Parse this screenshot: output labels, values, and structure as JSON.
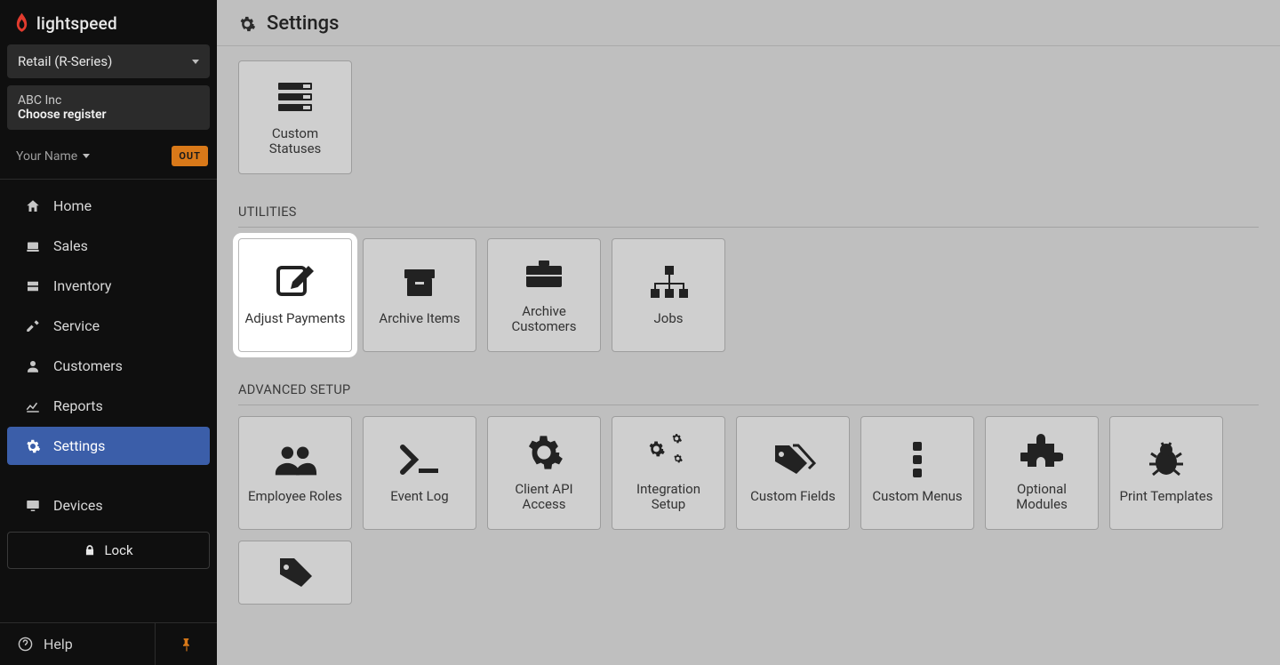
{
  "brand": {
    "name": "lightspeed"
  },
  "product_switcher": {
    "label": "Retail (R-Series)"
  },
  "register": {
    "org": "ABC Inc",
    "choose": "Choose register"
  },
  "user": {
    "name": "Your Name",
    "status_badge": "OUT"
  },
  "nav": {
    "items": [
      {
        "key": "home",
        "label": "Home"
      },
      {
        "key": "sales",
        "label": "Sales"
      },
      {
        "key": "inventory",
        "label": "Inventory"
      },
      {
        "key": "service",
        "label": "Service"
      },
      {
        "key": "customers",
        "label": "Customers"
      },
      {
        "key": "reports",
        "label": "Reports"
      },
      {
        "key": "settings",
        "label": "Settings"
      },
      {
        "key": "devices",
        "label": "Devices"
      }
    ]
  },
  "lock": {
    "label": "Lock"
  },
  "help": {
    "label": "Help"
  },
  "page": {
    "title": "Settings"
  },
  "sections": {
    "top_row": {
      "items": [
        {
          "label": "Custom Statuses"
        }
      ]
    },
    "utilities": {
      "title": "UTILITIES",
      "items": [
        {
          "label": "Adjust Payments",
          "highlight": true
        },
        {
          "label": "Archive Items"
        },
        {
          "label": "Archive Customers"
        },
        {
          "label": "Jobs"
        }
      ]
    },
    "advanced": {
      "title": "ADVANCED SETUP",
      "items": [
        {
          "label": "Employee Roles"
        },
        {
          "label": "Event Log"
        },
        {
          "label": "Client API Access"
        },
        {
          "label": "Integration Setup"
        },
        {
          "label": "Custom Fields"
        },
        {
          "label": "Custom Menus"
        },
        {
          "label": "Optional Modules"
        },
        {
          "label": "Print Templates"
        }
      ]
    }
  }
}
